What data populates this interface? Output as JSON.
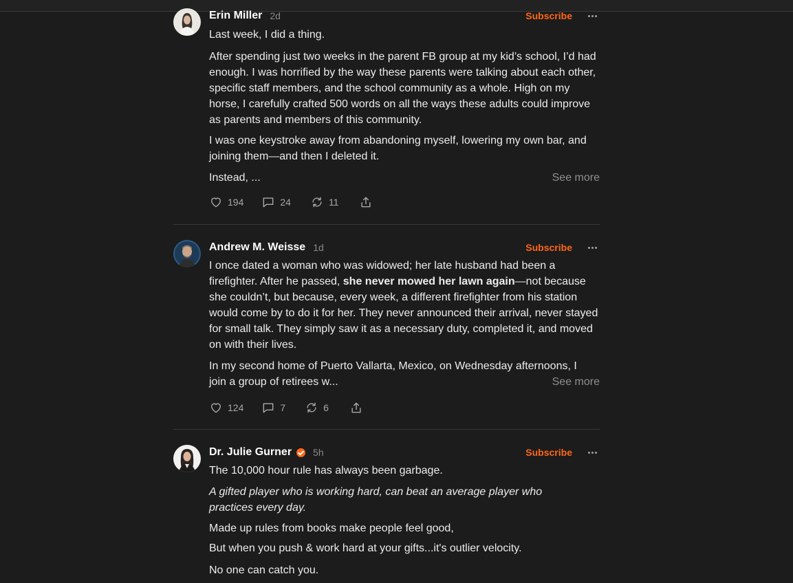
{
  "posts": [
    {
      "author": "Erin Miller",
      "verified": false,
      "time": "2d",
      "subscribe_label": "Subscribe",
      "paragraphs": [
        "Last week, I did a thing.",
        "After spending just two weeks in the parent FB group at my kid’s school, I’d had enough. I was horrified by the way these parents were talking about each other, specific staff members, and the school community as a whole. High on my horse, I carefully crafted 500 words on all the ways these adults could improve as parents and members of this community.",
        "I was one keystroke away from abandoning myself, lowering my own bar, and joining them—and then I deleted it."
      ],
      "truncated_text": "Instead, ...",
      "see_more_label": "See more",
      "likes": "194",
      "comments": "24",
      "restacks": "11"
    },
    {
      "author": "Andrew M. Weisse",
      "verified": false,
      "time": "1d",
      "subscribe_label": "Subscribe",
      "p1_before": "I once dated a woman who was widowed; her late husband had been a firefighter. After he passed, ",
      "p1_bold": "she never mowed her lawn again",
      "p1_after": "—not because she couldn’t, but because, every week, a different firefighter from his station would come by to do it for her. They never announced their arrival, never stayed for small talk. They simply saw it as a necessary duty, completed it, and moved on with their lives.",
      "truncated_text": "In my second home of Puerto Vallarta, Mexico, on Wednesday afternoons, I join a group of retirees w...",
      "see_more_label": "See more",
      "likes": "124",
      "comments": "7",
      "restacks": "6"
    },
    {
      "author": "Dr. Julie Gurner",
      "verified": true,
      "time": "5h",
      "subscribe_label": "Subscribe",
      "paragraphs": [
        "The 10,000 hour rule has always been garbage.",
        "A gifted player who is working hard, can beat an average player who practices every day.",
        "Made up rules from books make people feel good,",
        "But when you push & work hard at your gifts...it's outlier velocity.",
        "No one can catch you."
      ]
    }
  ],
  "icons": {
    "like": "heart-icon",
    "comment": "speech-bubble-icon",
    "restack": "restack-arrows-icon",
    "share": "share-upload-icon",
    "more": "ellipsis-icon",
    "verified": "verified-check-badge-icon"
  },
  "colors": {
    "background": "#1c1c1c",
    "accent": "#ff6719",
    "muted": "#8a8a8a"
  }
}
